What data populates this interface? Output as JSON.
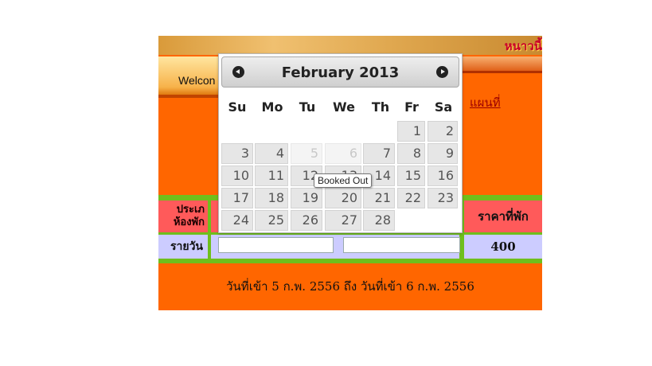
{
  "page": {
    "banner_text": "หนาวนี้",
    "welcome_text": "Welcon",
    "map_link": "แผนที่",
    "table": {
      "header_room_type": "ประเภ ห้องพัก",
      "header_price": "ราคาที่พัก",
      "row_label": "รายวัน",
      "row_price": "400"
    },
    "footer_text": "วันที่เข้า 5 ก.พ. 2556 ถึง วันที่เข้า 6 ก.พ. 2556"
  },
  "datepicker": {
    "title": "February 2013",
    "prev_icon": "prev-arrow-icon",
    "next_icon": "next-arrow-icon",
    "weekdays": [
      "Su",
      "Mo",
      "Tu",
      "We",
      "Th",
      "Fr",
      "Sa"
    ],
    "weeks": [
      [
        null,
        null,
        null,
        null,
        null,
        "1",
        "2"
      ],
      [
        "3",
        "4",
        "5",
        "6",
        "7",
        "8",
        "9"
      ],
      [
        "10",
        "11",
        "12",
        "13",
        "14",
        "15",
        "16"
      ],
      [
        "17",
        "18",
        "19",
        "20",
        "21",
        "22",
        "23"
      ],
      [
        "24",
        "25",
        "26",
        "27",
        "28",
        null,
        null
      ]
    ],
    "disabled_days": [
      "5",
      "6"
    ],
    "tooltip": "Booked Out"
  }
}
